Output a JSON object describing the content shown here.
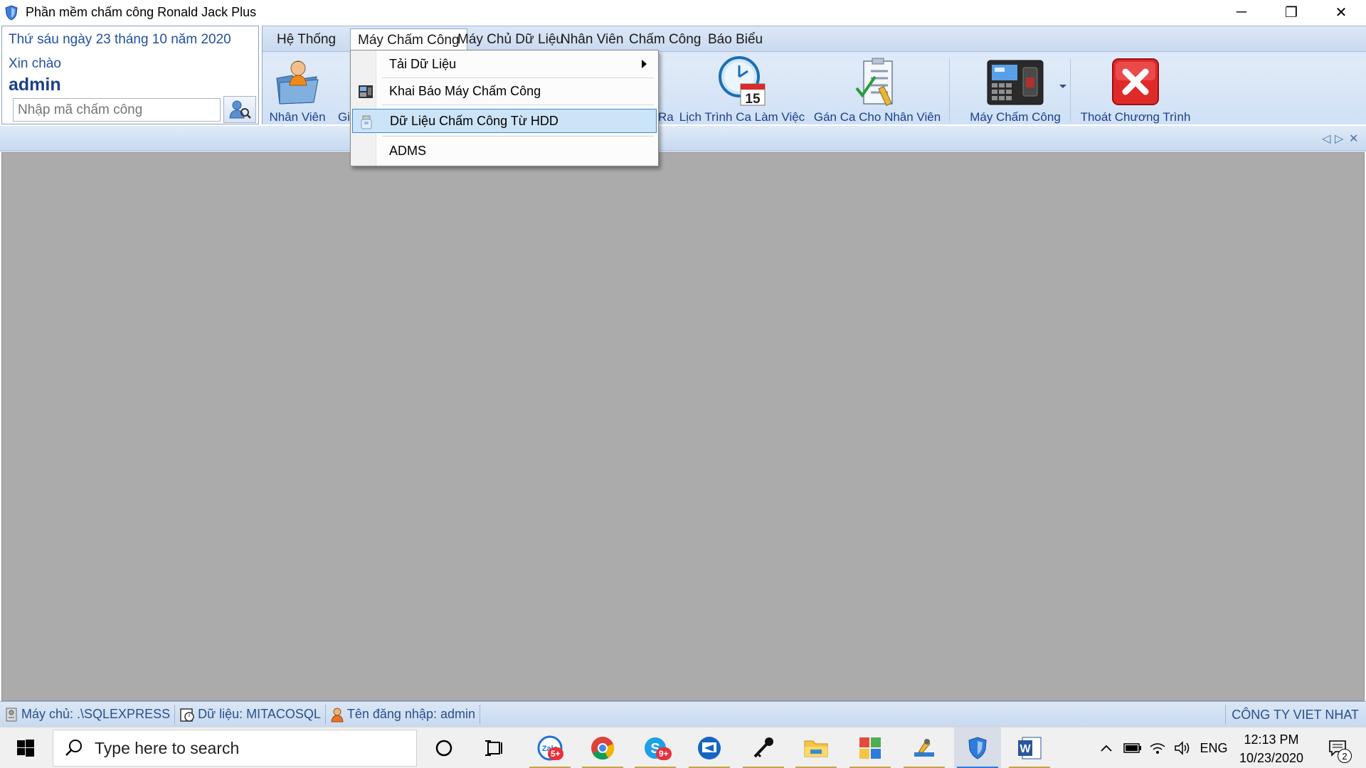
{
  "window": {
    "title": "Phần mềm chấm công Ronald Jack Plus",
    "minimize": "─",
    "restore": "❐",
    "close": "✕"
  },
  "info_panel": {
    "date": "Thứ sáu ngày 23 tháng 10 năm 2020",
    "greeting": "Xin chào",
    "username": "admin",
    "code_placeholder": "Nhập mã chấm công"
  },
  "menu_tabs": [
    {
      "label": "Hệ Thống"
    },
    {
      "label": "Máy Chấm Công"
    },
    {
      "label": "Máy Chủ Dữ Liệu"
    },
    {
      "label": "Nhân Viên"
    },
    {
      "label": "Chấm Công"
    },
    {
      "label": "Báo Biểu"
    }
  ],
  "ribbon_buttons": {
    "nhan_vien": "Nhân Viên",
    "gi_partial": "Gi",
    "ra_partial": "Ra",
    "lich_trinh": "Lịch Trình Ca Làm Việc",
    "calendar_day": "15",
    "gan_ca": "Gán Ca Cho Nhân Viên",
    "may_cham_cong": "Máy Chấm Công",
    "thoat": "Thoát Chương Trình"
  },
  "dropdown": {
    "items": [
      {
        "label": "Tải Dữ Liệu",
        "has_submenu": true
      },
      {
        "label": "Khai Báo Máy Chấm Công"
      },
      {
        "label": "Dữ Liệu Chấm Công Từ HDD",
        "highlighted": true
      },
      {
        "label": "ADMS"
      }
    ]
  },
  "statusbar": {
    "server": "Máy chủ: .\\SQLEXPRESS",
    "database": "Dữ liệu: MITACOSQL",
    "login": "Tên đăng nhập: admin",
    "company": "CÔNG TY VIET NHAT"
  },
  "taskbar": {
    "search_placeholder": "Type here to search",
    "zalo_label": "Zalo",
    "zalo_badge": "5+",
    "skype_badge": "9+",
    "language": "ENG",
    "time": "12:13 PM",
    "date": "10/23/2020",
    "notifications": "2"
  },
  "colors": {
    "accent_blue": "#2150a0",
    "ribbon_bg": "#d6e5f7",
    "main_bg": "#ababab",
    "menu_highlight": "#cce4f7",
    "exit_red": "#e02a2a"
  },
  "icons": [
    "app-shield-icon",
    "user-search-icon",
    "employee-folder-icon",
    "clock-calendar-icon",
    "checklist-icon",
    "attendance-device-icon",
    "exit-x-icon",
    "submenu-arrow-icon",
    "device-icon",
    "usb-drive-icon",
    "server-icon",
    "database-icon",
    "user-icon",
    "windows-start-icon",
    "search-icon",
    "cortana-icon",
    "task-view-icon",
    "chrome-icon",
    "skype-icon",
    "teamviewer-icon",
    "key-icon",
    "file-explorer-icon",
    "control-panel-icon",
    "tool-icon",
    "shield-app-icon",
    "word-icon",
    "chevron-up-icon",
    "battery-icon",
    "wifi-icon",
    "volume-icon",
    "notification-icon"
  ]
}
